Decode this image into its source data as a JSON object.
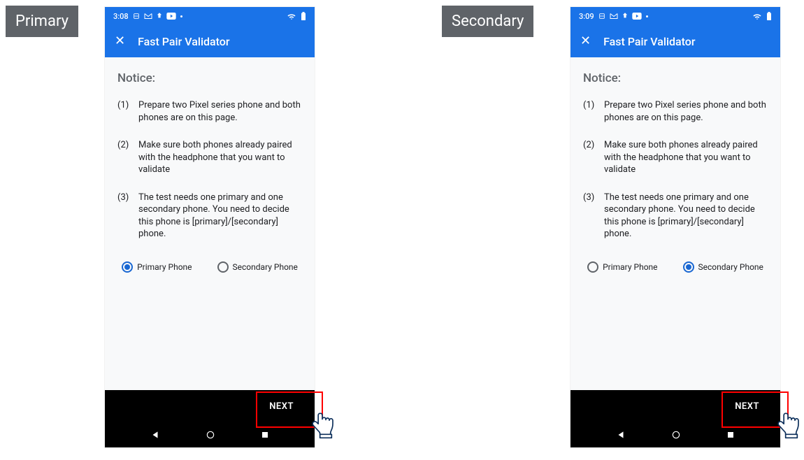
{
  "labels": {
    "primary": "Primary",
    "secondary": "Secondary"
  },
  "phones": [
    {
      "id": "primary",
      "status_time": "3:08",
      "app_title": "Fast Pair Validator",
      "notice_heading": "Notice:",
      "notice_items": [
        {
          "num": "(1)",
          "text": "Prepare two Pixel series phone and both phones are on this page."
        },
        {
          "num": "(2)",
          "text": "Make sure both phones already paired with the headphone that you want to validate"
        },
        {
          "num": "(3)",
          "text": "The test needs one primary and one secondary phone. You need to decide this phone is [primary]/[secondary] phone."
        }
      ],
      "radio_primary_label": "Primary Phone",
      "radio_secondary_label": "Secondary Phone",
      "radio_selected": "primary",
      "next_label": "NEXT"
    },
    {
      "id": "secondary",
      "status_time": "3:09",
      "app_title": "Fast Pair Validator",
      "notice_heading": "Notice:",
      "notice_items": [
        {
          "num": "(1)",
          "text": "Prepare two Pixel series phone and both phones are on this page."
        },
        {
          "num": "(2)",
          "text": "Make sure both phones already paired with the headphone that you want to validate"
        },
        {
          "num": "(3)",
          "text": "The test needs one primary and one secondary phone. You need to decide this phone is [primary]/[secondary] phone."
        }
      ],
      "radio_primary_label": "Primary Phone",
      "radio_secondary_label": "Secondary Phone",
      "radio_selected": "secondary",
      "next_label": "NEXT"
    }
  ]
}
